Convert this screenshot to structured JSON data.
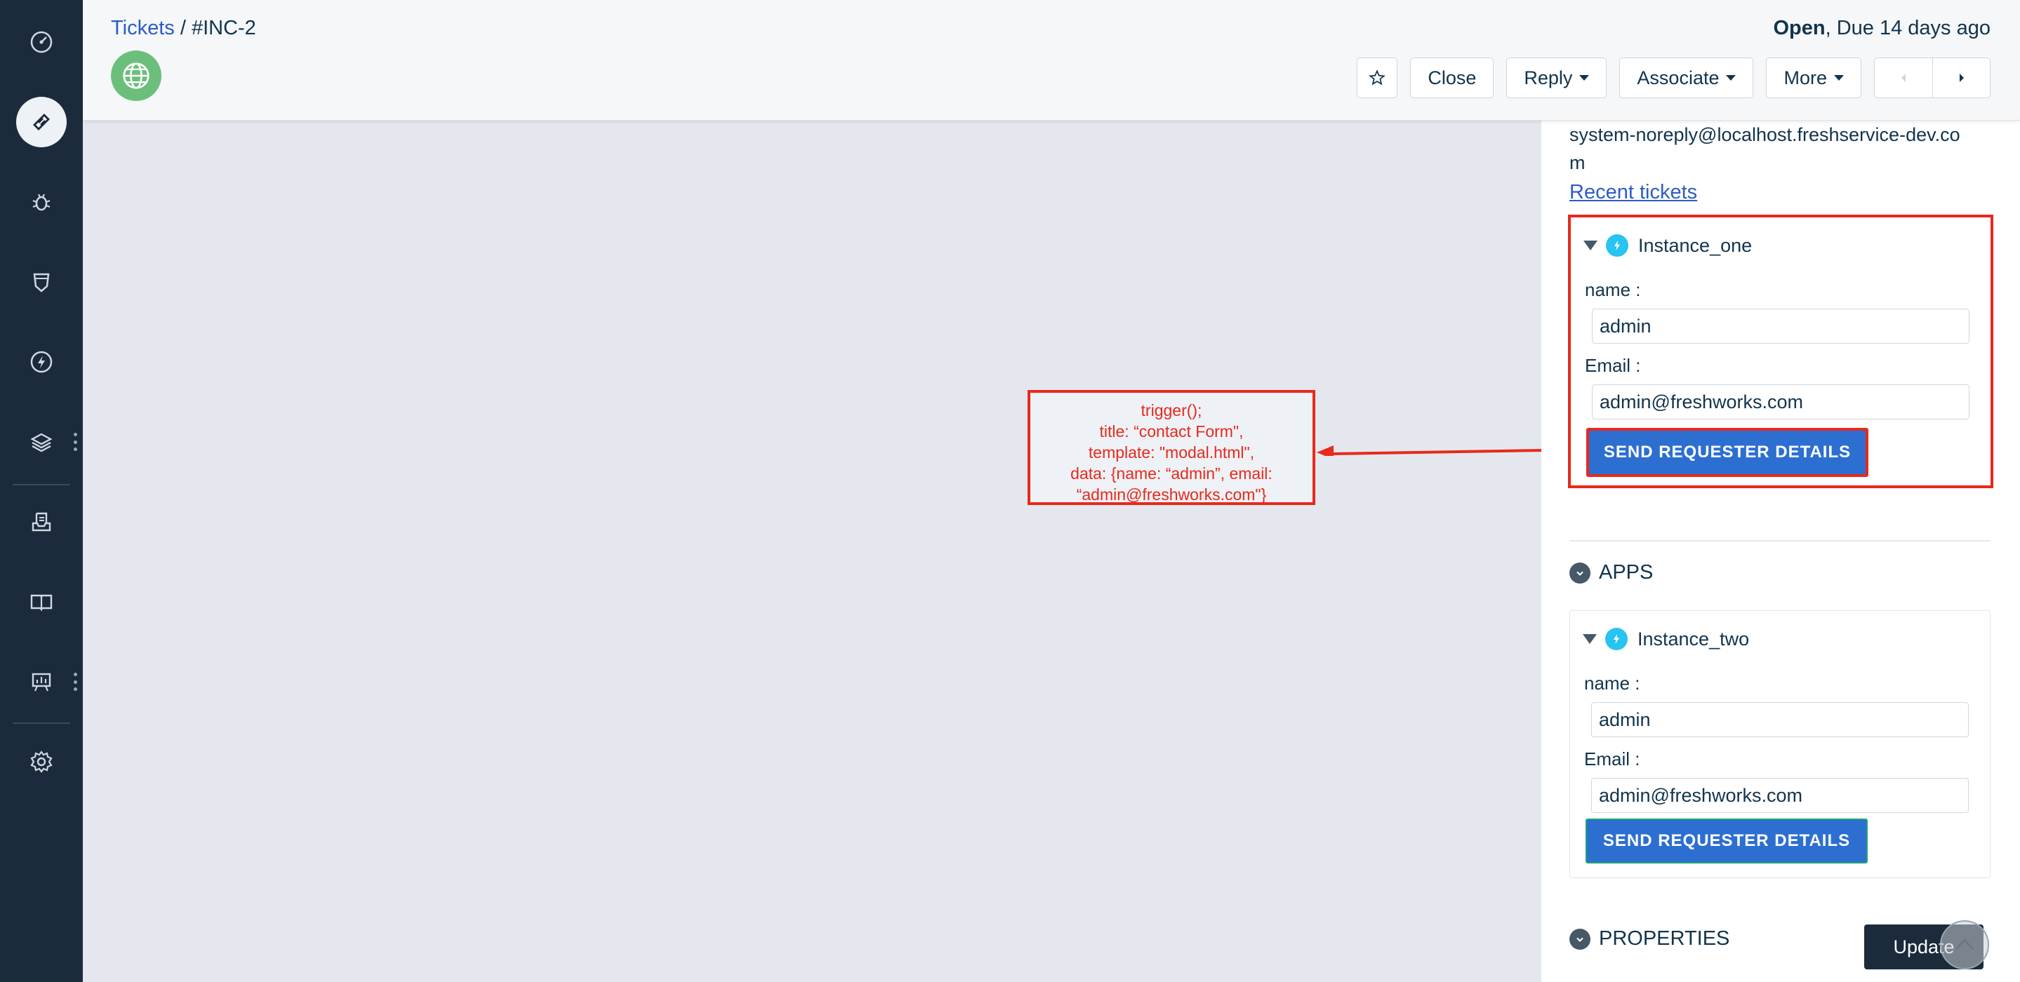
{
  "sidebar": {
    "items": [
      {
        "icon": "dashboard-gauge-icon"
      },
      {
        "icon": "ticket-icon",
        "active": true
      },
      {
        "icon": "bug-icon"
      },
      {
        "icon": "shield-icon"
      },
      {
        "icon": "lightning-icon"
      },
      {
        "icon": "layers-icon"
      },
      {
        "icon": "inbox-document-icon"
      },
      {
        "icon": "book-icon"
      },
      {
        "icon": "presentation-chart-icon"
      },
      {
        "icon": "gear-icon"
      }
    ]
  },
  "header": {
    "breadcrumb_link": "Tickets",
    "breadcrumb_sep": " / ",
    "breadcrumb_current": "#INC-2",
    "status_state": "Open",
    "status_due": ", Due 14 days ago",
    "toolbar": {
      "close_label": "Close",
      "reply_label": "Reply",
      "associate_label": "Associate",
      "more_label": "More"
    }
  },
  "annotation": {
    "lines": [
      "trigger();",
      "title: “contact Form\",",
      "template: \"modal.html\",",
      "data: {name: “admin”, email:",
      "“admin@freshworks.com\"}"
    ]
  },
  "right_panel": {
    "email": "system-noreply@localhost.freshservice-dev.com",
    "recent_tickets": "Recent tickets",
    "apps_heading": "APPS",
    "properties_heading": "PROPERTIES",
    "instances": [
      {
        "name": "Instance_one",
        "name_label": "name :",
        "name_value": "admin",
        "email_label": "Email :",
        "email_value": "admin@freshworks.com",
        "button_label": "SEND REQUESTER DETAILS"
      },
      {
        "name": "Instance_two",
        "name_label": "name :",
        "name_value": "admin",
        "email_label": "Email :",
        "email_value": "admin@freshworks.com",
        "button_label": "SEND REQUESTER DETAILS"
      }
    ],
    "update_label": "Update"
  },
  "colors": {
    "sidebar_bg": "#1c2b3b",
    "link": "#2c5cc5",
    "primary_button": "#2c6fd1",
    "annotation_red": "#e8291b",
    "app_icon": "#27c4f0"
  }
}
